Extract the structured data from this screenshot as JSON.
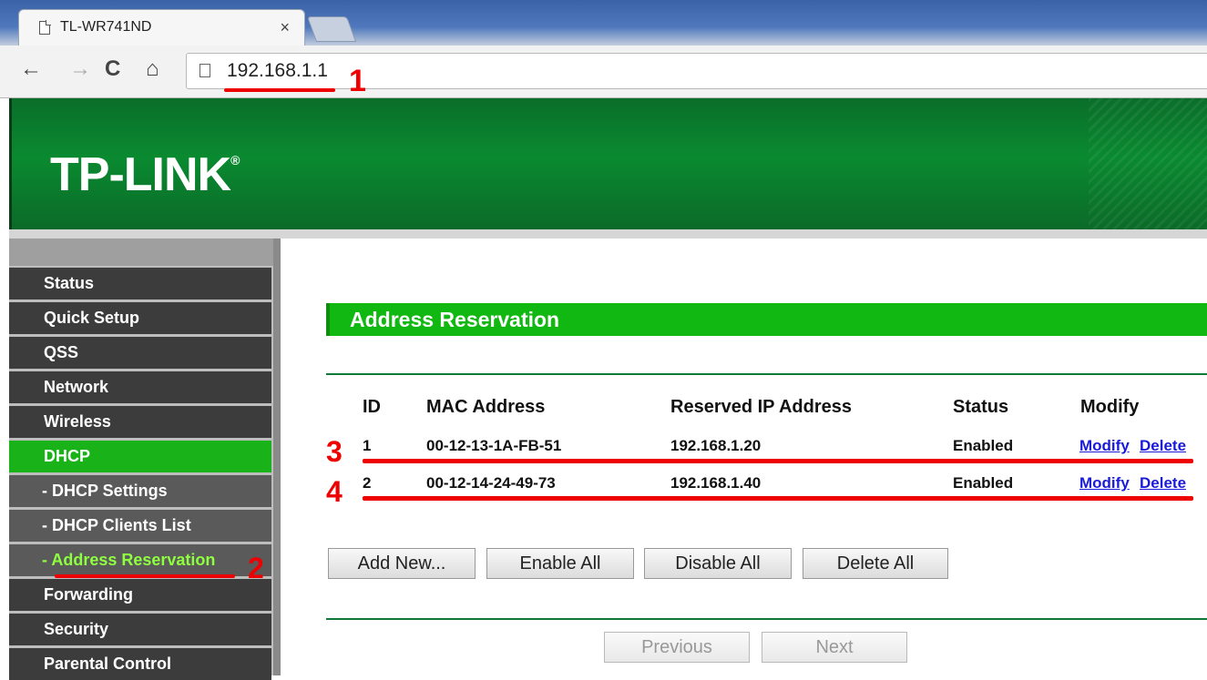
{
  "browser": {
    "tab_title": "TL-WR741ND",
    "tab_close": "×",
    "url": "192.168.1.1",
    "nav": {
      "back": "←",
      "forward": "→",
      "reload": "C",
      "home": "⌂"
    }
  },
  "header": {
    "logo": "TP-LINK",
    "logo_mark": "®"
  },
  "sidebar": {
    "items": [
      {
        "label": "Status"
      },
      {
        "label": "Quick Setup"
      },
      {
        "label": "QSS"
      },
      {
        "label": "Network"
      },
      {
        "label": "Wireless"
      },
      {
        "label": "DHCP"
      },
      {
        "label": "- DHCP Settings"
      },
      {
        "label": "- DHCP Clients List"
      },
      {
        "label": "- Address Reservation"
      },
      {
        "label": "Forwarding"
      },
      {
        "label": "Security"
      },
      {
        "label": "Parental Control"
      }
    ]
  },
  "main": {
    "section_title": "Address Reservation",
    "table": {
      "headers": [
        "ID",
        "MAC Address",
        "Reserved IP Address",
        "Status",
        "Modify"
      ],
      "rows": [
        {
          "id": "1",
          "mac": "00-12-13-1A-FB-51",
          "ip": "192.168.1.20",
          "status": "Enabled",
          "modify": "Modify",
          "delete": "Delete"
        },
        {
          "id": "2",
          "mac": "00-12-14-24-49-73",
          "ip": "192.168.1.40",
          "status": "Enabled",
          "modify": "Modify",
          "delete": "Delete"
        }
      ]
    },
    "buttons": {
      "add_new": "Add New...",
      "enable_all": "Enable All",
      "disable_all": "Disable All",
      "delete_all": "Delete All",
      "previous": "Previous",
      "next": "Next"
    }
  },
  "annotations": {
    "a1": "1",
    "a2": "2",
    "a3": "3",
    "a4": "4",
    "color": "#e00000"
  },
  "colors": {
    "banner_green": "#0a8a30",
    "menu_active": "#19b319",
    "section_head": "#12b812",
    "link": "#1a1ad8"
  }
}
